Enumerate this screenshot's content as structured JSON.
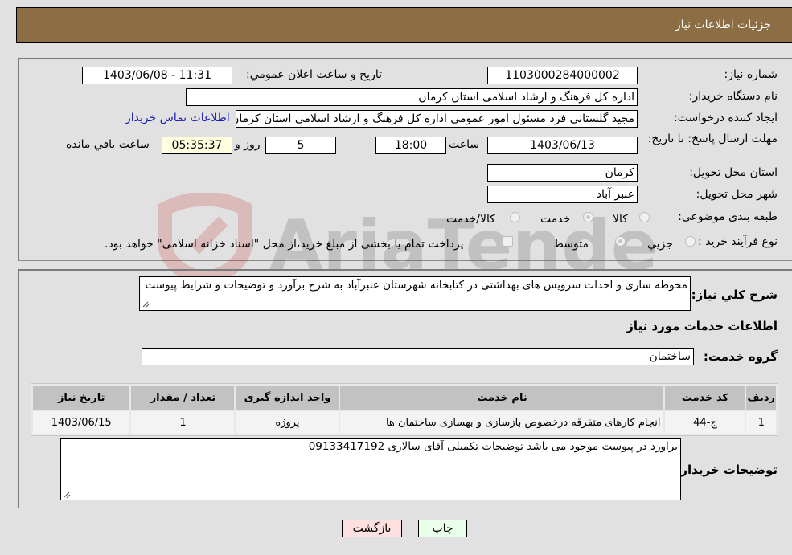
{
  "header": {
    "title": "جزئيات اطلاعات نياز"
  },
  "form": {
    "need_number": {
      "label": "شماره نياز:",
      "value": "1103000284000002"
    },
    "announce": {
      "label": "تاريخ و ساعت اعلان عمومي:",
      "value": "1403/06/08 - 11:31"
    },
    "buyer_org": {
      "label": "نام دستگاه خريدار:",
      "value": "اداره کل فرهنگ و ارشاد اسلامی استان کرمان"
    },
    "requester": {
      "label": "ايجاد کننده درخواست:",
      "value": "مجيد گلستانی فرد مسئول امور عمومی اداره کل فرهنگ و ارشاد اسلامی استان کرمان",
      "contact_link": "اطلاعات تماس خريدار"
    },
    "deadline": {
      "label": "مهلت ارسال پاسخ: تا تاريخ:",
      "date": "1403/06/13",
      "time_label": "ساعت",
      "time": "18:00",
      "days": "5",
      "days_label": "روز و",
      "remaining": "05:35:37",
      "remaining_label": "ساعت باقي مانده"
    },
    "province": {
      "label": "استان محل تحويل:",
      "value": "کرمان"
    },
    "city": {
      "label": "شهر محل تحويل:",
      "value": "عنبر آباد"
    },
    "category": {
      "label": "طبقه بندی موضوعی:",
      "options": [
        "کالا",
        "خدمت",
        "کالا/خدمت"
      ],
      "selected": "خدمت"
    },
    "purchase_type": {
      "label": "نوع فرآيند خريد :",
      "options": [
        "جزيي",
        "متوسط"
      ],
      "selected": "متوسط",
      "treasury_note": "پرداخت تمام يا بخشی از مبلغ خريد،از محل \"اسناد خزانه اسلامی\" خواهد بود."
    }
  },
  "details": {
    "summary_label": "شرح کلي نياز:",
    "summary": "محوطه سازی و احداث سرويس های بهداشتی در کتابخانه شهرستان عنبرآباد به شرح برآورد و توضيحات و شرايط پيوست",
    "services_title": "اطلاعات خدمات مورد نياز",
    "service_group_label": "گروه خدمت:",
    "service_group": "ساختمان",
    "table": {
      "headers": [
        "رديف",
        "کد خدمت",
        "نام خدمت",
        "واحد اندازه گيری",
        "تعداد / مقدار",
        "تاريخ نياز"
      ],
      "rows": [
        [
          "1",
          "ج-44",
          "انجام کارهای متفرقه درخصوص بازسازی و بهسازی ساختمان ها",
          "پروژه",
          "1",
          "1403/06/15"
        ]
      ]
    },
    "buyer_notes_label": "توضيحات خريدار:",
    "buyer_notes": "براورد در پيوست موجود می باشد توضيحات تکميلی آقای سالاری 09133417192"
  },
  "buttons": {
    "print": "چاپ",
    "back": "بازگشت"
  },
  "colors": {
    "header": "#8c6d44",
    "back_btn": "#ffe0e0",
    "print_btn": "#eaffea",
    "link": "#1a1ab8"
  },
  "watermark": {
    "text": "AriaTender.neT"
  }
}
